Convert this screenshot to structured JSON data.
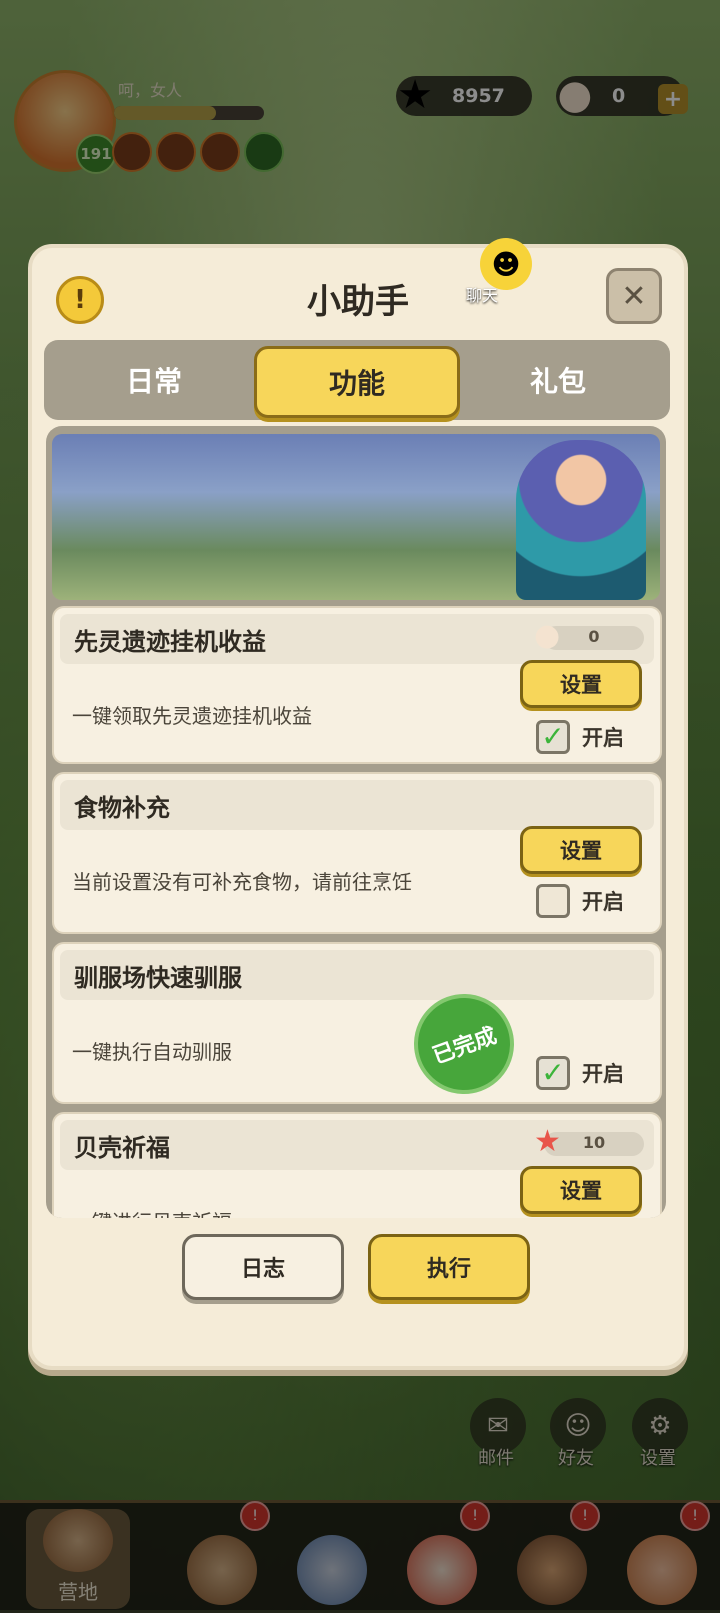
{
  "hud": {
    "player_name": "呵，女人",
    "level": "191",
    "xp_fraction": 0.68,
    "starfish_count": "8957",
    "pearl_count": "0"
  },
  "dialog": {
    "title": "小助手",
    "chat_label": "聊天",
    "tabs": [
      {
        "label": "日常",
        "active": false
      },
      {
        "label": "功能",
        "active": true
      },
      {
        "label": "礼包",
        "active": false
      }
    ],
    "tasks": [
      {
        "title": "先灵遗迹挂机收益",
        "cost_icon": "pearl-icon",
        "cost": "0",
        "desc": "一键领取先灵遗迹挂机收益",
        "set_label": "设置",
        "toggle_label": "开启",
        "enabled": true
      },
      {
        "title": "食物补充",
        "desc": "当前设置没有可补充食物，请前往烹饪",
        "set_label": "设置",
        "toggle_label": "开启",
        "enabled": false
      },
      {
        "title": "驯服场快速驯服",
        "desc": "一键执行自动驯服",
        "toggle_label": "开启",
        "enabled": true,
        "stamp": "已完成"
      },
      {
        "title": "贝壳祈福",
        "cost_icon": "starfish-icon",
        "cost": "10",
        "desc": "一键进行贝壳祈福",
        "set_label": "设置"
      }
    ],
    "log_label": "日志",
    "execute_label": "执行"
  },
  "side_buttons": {
    "mail": "邮件",
    "friends": "好友",
    "settings": "设置"
  },
  "nav": {
    "camp": "营地"
  }
}
